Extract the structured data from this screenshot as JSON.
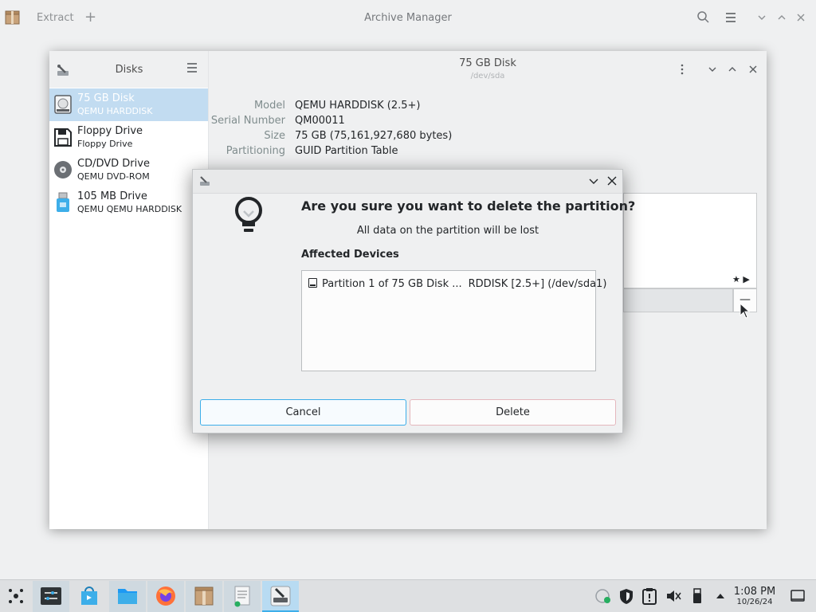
{
  "archive_manager": {
    "title": "Archive Manager",
    "extract_label": "Extract",
    "add_label": "+"
  },
  "disks": {
    "sidebar_title": "Disks",
    "drives": [
      {
        "name": "75 GB Disk",
        "sub": "QEMU HARDDISK",
        "icon": "hard-disk-icon",
        "selected": true
      },
      {
        "name": "Floppy Drive",
        "sub": "Floppy Drive",
        "icon": "floppy-icon",
        "selected": false
      },
      {
        "name": "CD/DVD Drive",
        "sub": "QEMU DVD-ROM",
        "icon": "optical-disc-icon",
        "selected": false
      },
      {
        "name": "105 MB Drive",
        "sub": "QEMU QEMU HARDDISK",
        "icon": "usb-drive-icon",
        "selected": false
      }
    ],
    "header_title": "75 GB Disk",
    "header_subtitle": "/dev/sda",
    "info": [
      {
        "key": "Model",
        "value": "QEMU HARDDISK (2.5+)"
      },
      {
        "key": "Serial Number",
        "value": "QM00011"
      },
      {
        "key": "Size",
        "value": "75 GB (75,161,927,680 bytes)"
      },
      {
        "key": "Partitioning",
        "value": "GUID Partition Table"
      }
    ],
    "volume_stars": "★ ▶",
    "volume_minus": "—"
  },
  "dialog": {
    "heading": "Are you sure you want to delete the partition?",
    "subtext": "All data on the partition will be lost",
    "affected_label": "Affected Devices",
    "device_part1": "Partition 1 of 75 GB Disk ...",
    "device_part2": "RDDISK [2.5+] (/dev/sda1)",
    "cancel_label": "Cancel",
    "delete_label": "Delete"
  },
  "taskbar": {
    "time": "1:08 PM",
    "date": "10/26/24"
  },
  "colors": {
    "accent": "#3daee9",
    "selection": "#c2dcf1",
    "destructive_border": "#e4b7bd"
  }
}
